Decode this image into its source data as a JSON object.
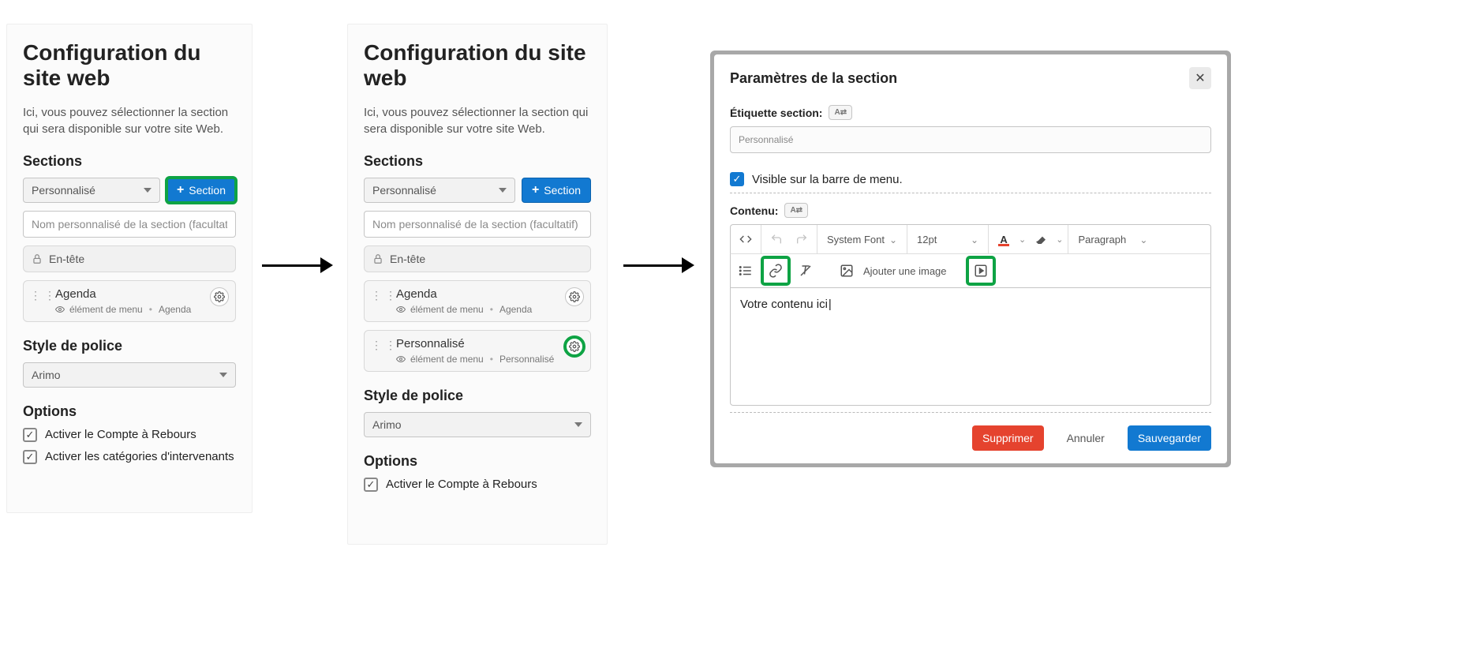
{
  "panel1": {
    "title": "Configuration du site web",
    "desc": "Ici, vous pouvez sélectionner la section qui sera disponible sur votre site Web.",
    "sections_heading": "Sections",
    "select_value": "Personnalisé",
    "add_button": "Section",
    "name_placeholder": "Nom personnalisé de la section (facultatif)",
    "header_chip": "En-tête",
    "card1": {
      "name": "Agenda",
      "meta_menu": "élément de menu",
      "meta_tag": "Agenda"
    },
    "style_heading": "Style de police",
    "font_value": "Arimo",
    "options_heading": "Options",
    "opt1": "Activer le Compte à Rebours",
    "opt2": "Activer les catégories d'intervenants"
  },
  "panel2": {
    "title": "Configuration du site web",
    "desc": "Ici, vous pouvez sélectionner la section qui sera disponible sur votre site Web.",
    "sections_heading": "Sections",
    "select_value": "Personnalisé",
    "add_button": "Section",
    "name_placeholder": "Nom personnalisé de la section (facultatif)",
    "header_chip": "En-tête",
    "card1": {
      "name": "Agenda",
      "meta_menu": "élément de menu",
      "meta_tag": "Agenda"
    },
    "card2": {
      "name": "Personnalisé",
      "meta_menu": "élément de menu",
      "meta_tag": "Personnalisé"
    },
    "style_heading": "Style de police",
    "font_value": "Arimo",
    "options_heading": "Options",
    "opt1": "Activer le Compte à Rebours"
  },
  "modal": {
    "title": "Paramètres de la section",
    "label_etiquette": "Étiquette section:",
    "etiquette_value": "Personnalisé",
    "visible_label": "Visible sur la barre de menu.",
    "contenu_label": "Contenu:",
    "toolbar": {
      "font": "System Font",
      "size": "12pt",
      "paragraph": "Paragraph",
      "add_image": "Ajouter une image"
    },
    "body_text": "Votre contenu ici",
    "footer": {
      "delete": "Supprimer",
      "cancel": "Annuler",
      "save": "Sauvegarder"
    }
  }
}
